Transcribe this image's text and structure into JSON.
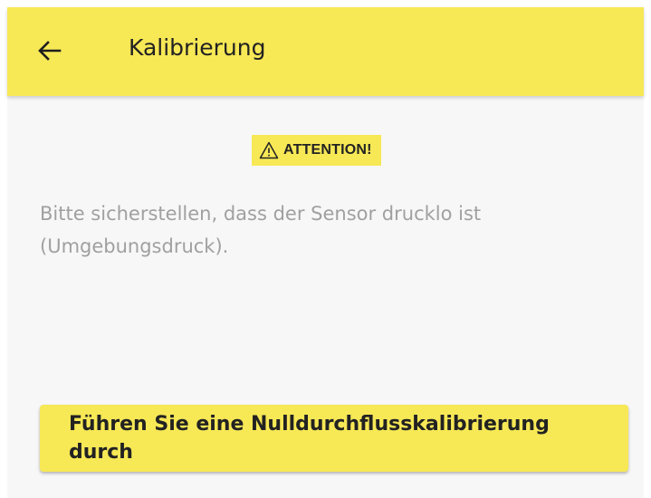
{
  "app_bar": {
    "back_icon": "arrow-left-icon",
    "title": "Kalibrierung"
  },
  "attention": {
    "icon": "warning-triangle-icon",
    "label": "ATTENTION!"
  },
  "message": "Bitte sicherstellen, dass der Sensor drucklo ist (Umgebungsdruck).",
  "action_button": {
    "label": "Führen Sie eine Nulldurchflusskalibrierung durch"
  },
  "colors": {
    "accent": "#f7e856",
    "background": "#f7f7f7",
    "message_text": "#a0a0a0",
    "primary_text": "#222222"
  }
}
